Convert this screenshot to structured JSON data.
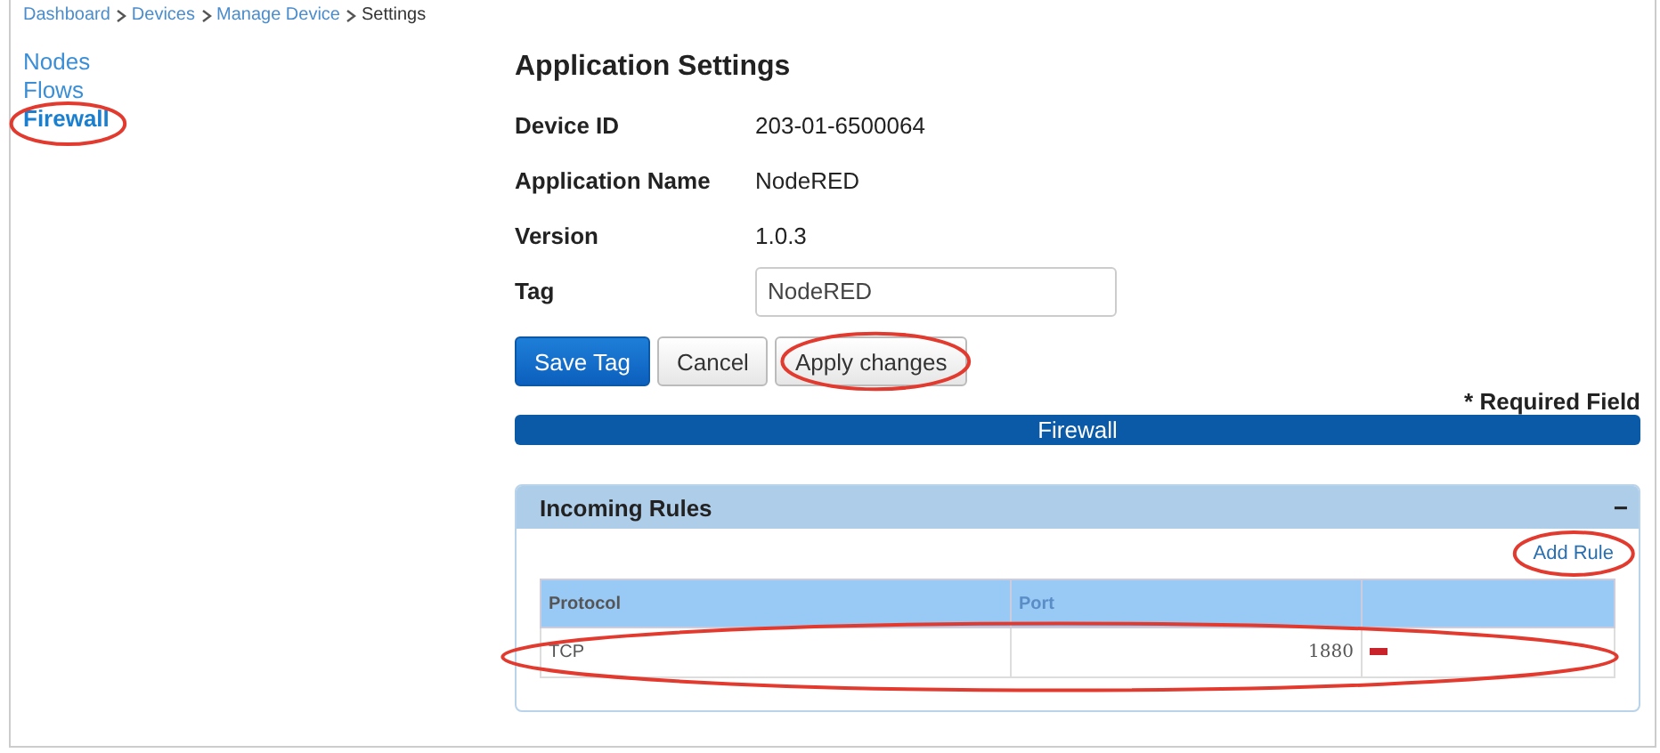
{
  "breadcrumb": [
    "Dashboard",
    "Devices",
    "Manage Device",
    "Settings"
  ],
  "sidebar": {
    "items": [
      {
        "label": "Nodes",
        "selected": false
      },
      {
        "label": "Flows",
        "selected": false
      },
      {
        "label": "Firewall",
        "selected": true,
        "highlighted": true
      }
    ]
  },
  "title": "Application Settings",
  "fields": [
    {
      "label": "Device ID",
      "value": "203-01-6500064",
      "kind": "text"
    },
    {
      "label": "Application Name",
      "value": "NodeRED",
      "kind": "text"
    },
    {
      "label": "Version",
      "value": "1.0.3",
      "kind": "text"
    },
    {
      "label": "Tag",
      "value": "NodeRED",
      "kind": "input"
    }
  ],
  "buttons": [
    {
      "label": "Save Tag",
      "kind": "primary"
    },
    {
      "label": "Cancel",
      "kind": "default"
    },
    {
      "label": "Apply changes",
      "kind": "default",
      "highlighted": true
    }
  ],
  "required_note": "* Required Field",
  "section_bar": "Firewall",
  "panel": {
    "title": "Incoming Rules",
    "collapse": "−",
    "add_link": {
      "label": "Add Rule",
      "highlighted": true
    },
    "columns": [
      "Protocol",
      "Port"
    ],
    "rows": [
      {
        "protocol": "TCP",
        "port": "1880",
        "highlighted": true
      }
    ]
  }
}
